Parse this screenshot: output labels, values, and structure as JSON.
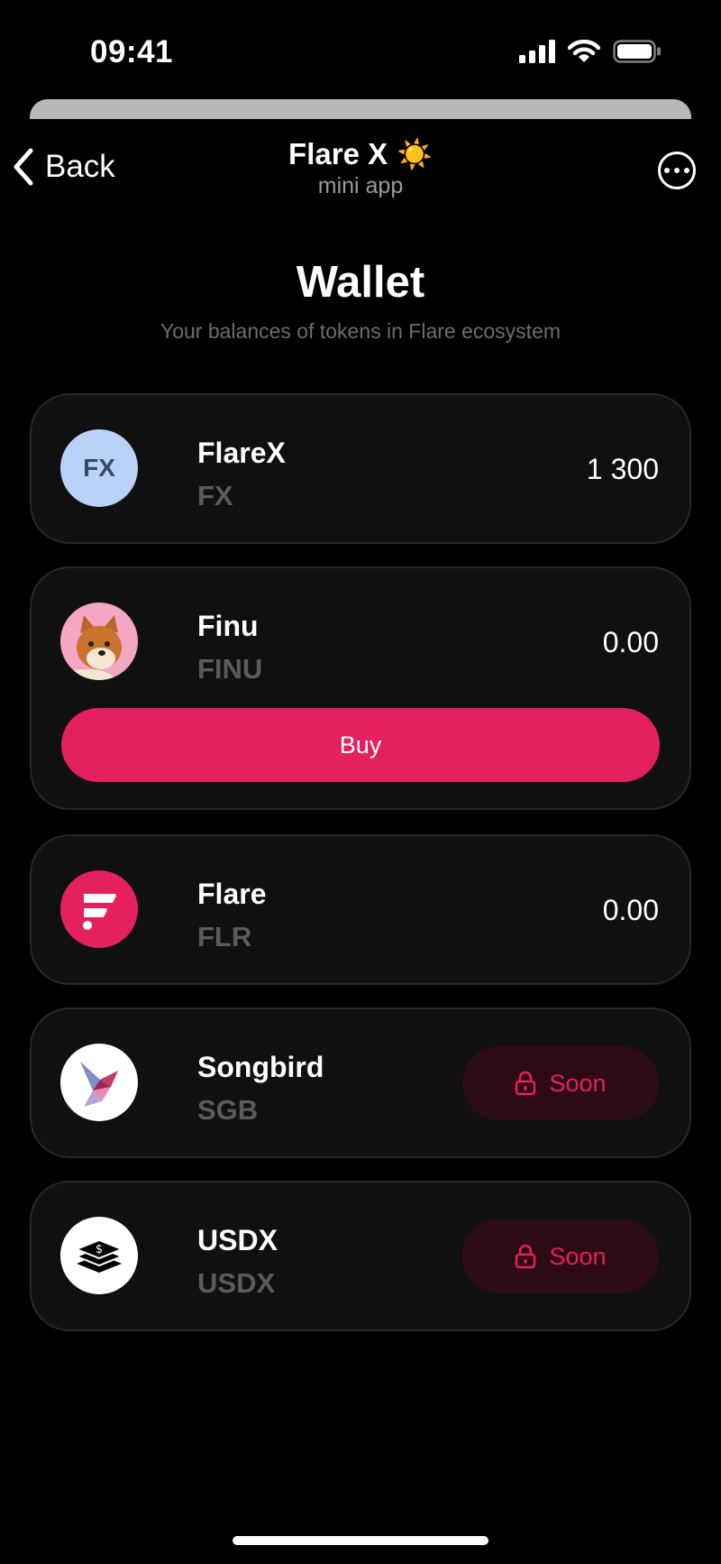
{
  "status": {
    "time": "09:41"
  },
  "nav": {
    "back_label": "Back",
    "title": "Flare X",
    "title_emoji": "☀️",
    "subtitle": "mini app"
  },
  "header": {
    "title": "Wallet",
    "subtitle": "Your balances of tokens in Flare ecosystem"
  },
  "tokens": [
    {
      "name": "FlareX",
      "symbol": "FX",
      "balance": "1 300",
      "logo_text": "FX"
    },
    {
      "name": "Finu",
      "symbol": "FINU",
      "balance": "0.00",
      "action": "Buy"
    },
    {
      "name": "Flare",
      "symbol": "FLR",
      "balance": "0.00"
    },
    {
      "name": "Songbird",
      "symbol": "SGB",
      "status": "Soon"
    },
    {
      "name": "USDX",
      "symbol": "USDX",
      "status": "Soon"
    }
  ],
  "colors": {
    "accent": "#e5205e",
    "card_bg": "#101010",
    "soon_bg": "#2d0b14",
    "fx_logo_bg": "#b9d2f5"
  }
}
